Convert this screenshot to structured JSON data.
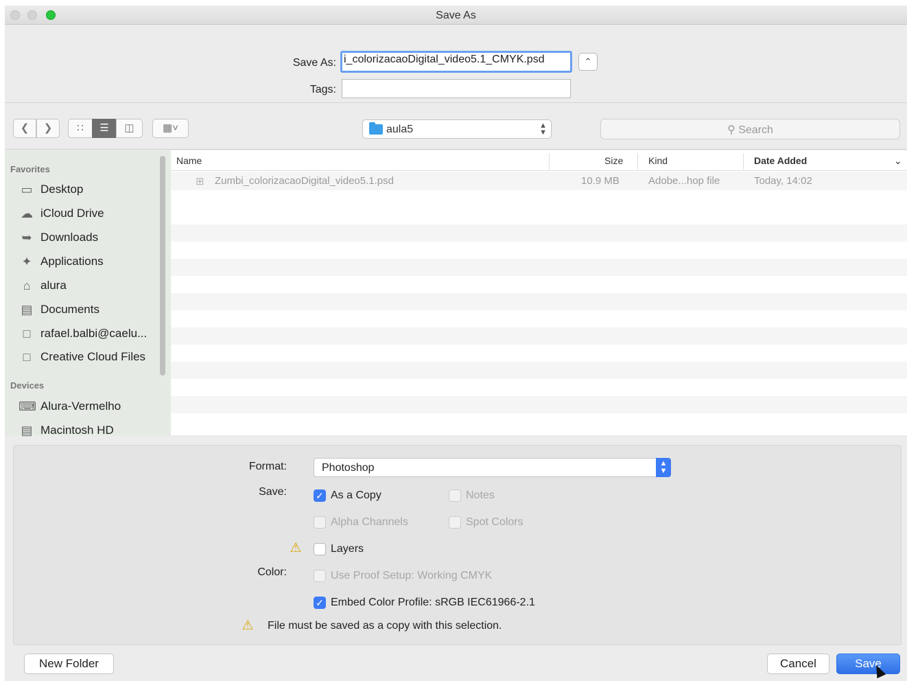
{
  "window": {
    "title": "Save As"
  },
  "save_as": {
    "label": "Save As:",
    "filename": "i_colorizacaoDigital_video5.1_CMYK.psd",
    "tags_label": "Tags:",
    "tags_value": "",
    "expand_icon": "chevron-up-icon"
  },
  "toolbar": {
    "back_icon": "chevron-left-icon",
    "forward_icon": "chevron-right-icon",
    "view_icons": [
      "icon-view-icon",
      "list-view-icon",
      "column-view-icon"
    ],
    "group_icon": "group-grid-icon",
    "location": "aula5",
    "search_placeholder": "Search"
  },
  "sidebar": {
    "favorites_header": "Favorites",
    "favorites": [
      {
        "label": "Desktop",
        "icon": "desktop-icon"
      },
      {
        "label": "iCloud Drive",
        "icon": "cloud-icon"
      },
      {
        "label": "Downloads",
        "icon": "download-icon"
      },
      {
        "label": "Applications",
        "icon": "applications-icon"
      },
      {
        "label": "alura",
        "icon": "home-icon"
      },
      {
        "label": "Documents",
        "icon": "documents-icon"
      },
      {
        "label": "rafael.balbi@caelu...",
        "icon": "folder-icon"
      },
      {
        "label": "Creative Cloud Files",
        "icon": "folder-icon"
      }
    ],
    "devices_header": "Devices",
    "devices": [
      {
        "label": "Alura-Vermelho",
        "icon": "network-drive-icon"
      },
      {
        "label": "Macintosh HD",
        "icon": "hard-drive-icon"
      }
    ]
  },
  "filelist": {
    "columns": {
      "name": "Name",
      "size": "Size",
      "kind": "Kind",
      "date": "Date Added"
    },
    "rows": [
      {
        "name": "Zumbi_colorizacaoDigital_video5.1.psd",
        "size": "10.9 MB",
        "kind": "Adobe...hop file",
        "date": "Today, 14:02"
      }
    ]
  },
  "options": {
    "format_label": "Format:",
    "format_value": "Photoshop",
    "save_label": "Save:",
    "color_label": "Color:",
    "checkboxes": {
      "as_a_copy": "As a Copy",
      "notes": "Notes",
      "alpha_channels": "Alpha Channels",
      "spot_colors": "Spot Colors",
      "layers": "Layers",
      "use_proof_setup": "Use Proof Setup:  Working CMYK",
      "embed_color_profile": "Embed Color Profile:  sRGB IEC61966-2.1"
    },
    "warning_text": "File must be saved as a copy with this selection."
  },
  "buttons": {
    "new_folder": "New Folder",
    "cancel": "Cancel",
    "save": "Save"
  },
  "colors": {
    "accent": "#3b7bf6",
    "warning": "#d9a400"
  }
}
